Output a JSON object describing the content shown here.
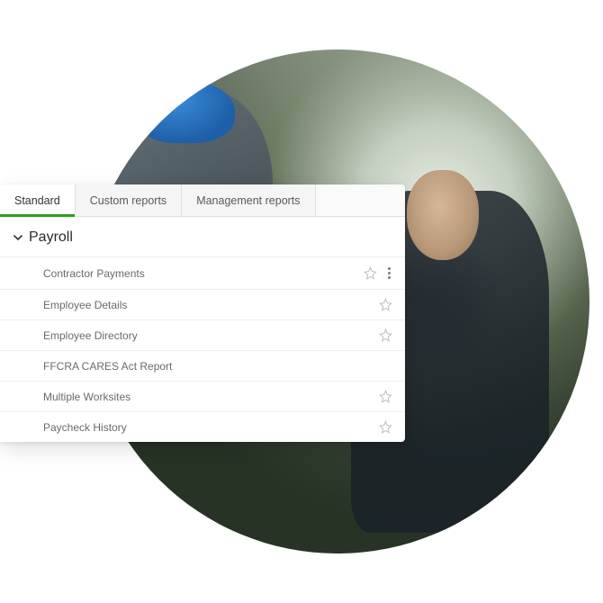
{
  "tabs": [
    {
      "label": "Standard",
      "active": true
    },
    {
      "label": "Custom reports",
      "active": false
    },
    {
      "label": "Management reports",
      "active": false
    }
  ],
  "section": {
    "title": "Payroll",
    "expanded": true
  },
  "reports": [
    {
      "label": "Contractor Payments",
      "star": true,
      "menu": true
    },
    {
      "label": "Employee Details",
      "star": true,
      "menu": false
    },
    {
      "label": "Employee Directory",
      "star": true,
      "menu": false
    },
    {
      "label": "FFCRA CARES Act Report",
      "star": false,
      "menu": false
    },
    {
      "label": "Multiple Worksites",
      "star": true,
      "menu": false
    },
    {
      "label": "Paycheck History",
      "star": true,
      "menu": false
    }
  ],
  "colors": {
    "accent": "#2ca01c"
  }
}
